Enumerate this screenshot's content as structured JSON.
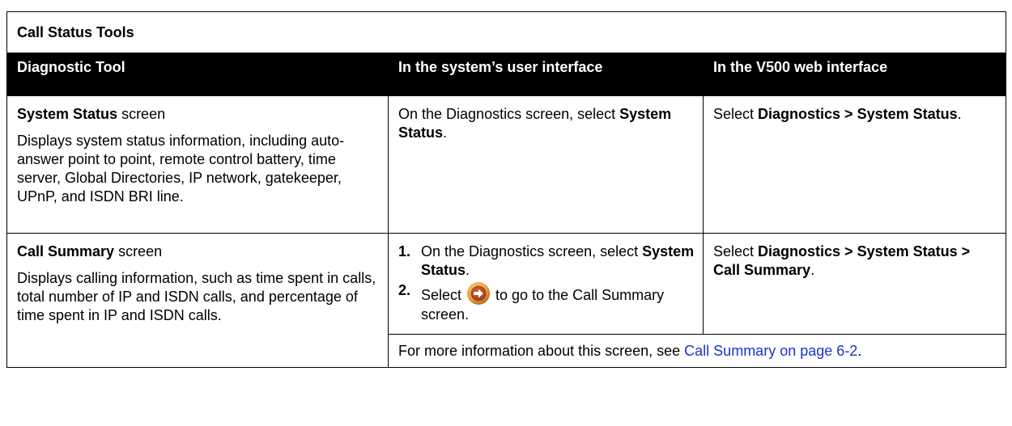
{
  "table": {
    "title": "Call Status Tools",
    "headers": [
      "Diagnostic Tool",
      "In the system’s user interface",
      "In the V500 web interface"
    ],
    "rows": [
      {
        "tool_name": "System Status",
        "tool_suffix": " screen",
        "tool_description": "Displays system status information, including auto-answer point to point, remote control battery, time server, Global Directories, IP network, gatekeeper, UPnP, and ISDN BRI line.",
        "ui_prefix": "On the Diagnostics screen, select ",
        "ui_bold": "System Status",
        "ui_suffix": ".",
        "web_prefix": "Select ",
        "web_bold": "Diagnostics > System Status",
        "web_suffix": "."
      },
      {
        "tool_name": "Call Summary",
        "tool_suffix": " screen",
        "tool_description": "Displays calling information, such as time spent in calls, total number of IP and ISDN calls, and percentage of time spent in IP and ISDN calls.",
        "steps": [
          {
            "number": "1.",
            "prefix": "On the Diagnostics screen, select ",
            "bold": "System Status",
            "suffix": "."
          },
          {
            "number": "2.",
            "prefix": "Select",
            "icon": "forward-arrow-icon",
            "suffix": "to go to the Call Summary screen."
          }
        ],
        "web_prefix": "Select ",
        "web_bold": "Diagnostics > System Status > Call Summary",
        "web_suffix": ".",
        "more_info_prefix": "For more information about this screen, see ",
        "more_info_link": "Call Summary on page 6-2",
        "more_info_suffix": "."
      }
    ]
  },
  "colors": {
    "header_bg": "#000000",
    "header_text": "#ffffff",
    "link": "#1a33cc",
    "icon_outer": "#e8a23a",
    "icon_inner": "#9b3a1a"
  }
}
